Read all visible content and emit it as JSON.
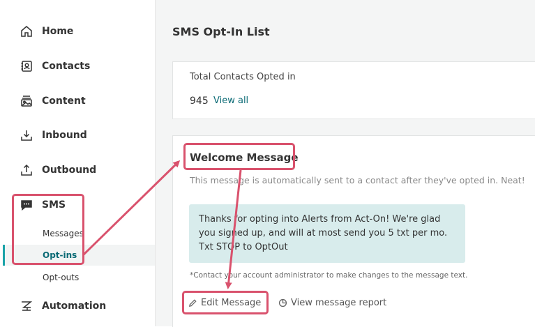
{
  "sidebar": {
    "items": [
      {
        "label": "Home",
        "icon": "home-icon"
      },
      {
        "label": "Contacts",
        "icon": "contacts-icon"
      },
      {
        "label": "Content",
        "icon": "content-icon"
      },
      {
        "label": "Inbound",
        "icon": "inbound-icon"
      },
      {
        "label": "Outbound",
        "icon": "outbound-icon"
      },
      {
        "label": "SMS",
        "icon": "sms-icon"
      },
      {
        "label": "Automation",
        "icon": "automation-icon"
      }
    ],
    "sms_subitems": [
      {
        "label": "Messages"
      },
      {
        "label": "Opt-ins",
        "active": true
      },
      {
        "label": "Opt-outs"
      }
    ]
  },
  "main": {
    "title": "SMS Opt-In List",
    "summary": {
      "label": "Total Contacts Opted in",
      "count": "945",
      "view_all": "View all"
    },
    "welcome": {
      "title": "Welcome Message",
      "description": "This message is automatically sent to a contact after they've opted in. Neat!",
      "message_lines": [
        "Thanks for opting into Alerts from Act-On! We're glad",
        "you signed up, and will at most send you 5 txt per mo.",
        "Txt STOP to OptOut"
      ],
      "note": "*Contact your account administrator to make changes to the message text.",
      "edit_label": "Edit Message",
      "report_label": "View message report"
    }
  },
  "colors": {
    "accent": "#0a6a75",
    "active_bar": "#1aa3a8",
    "message_bg": "#d8ecec",
    "annotation": "#d9526d"
  }
}
